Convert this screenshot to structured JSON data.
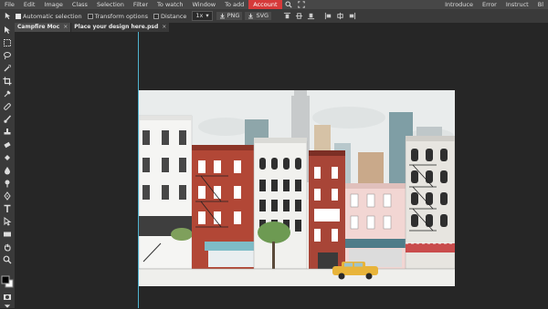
{
  "menubar": {
    "items": [
      "File",
      "Edit",
      "Image",
      "Class",
      "Selection",
      "Filter",
      "To watch",
      "Window",
      "To add",
      "Account"
    ],
    "active": "Account",
    "right": [
      "Introduce",
      "Error",
      "Instruct",
      "Bl"
    ]
  },
  "options": {
    "auto_select": "Automatic selection",
    "transform": "Transform options",
    "distance": "Distance",
    "zoom": "1x",
    "png": "PNG",
    "svg": "SVG"
  },
  "tabs": [
    {
      "label": "Campfire Moc",
      "close": "×"
    },
    {
      "label": "Place your design here.psd",
      "close": "×"
    }
  ],
  "colors": {
    "accent": "#d63a3a",
    "guide": "#4fb3cf",
    "bg": "#262626",
    "panel": "#3a3a3a"
  }
}
